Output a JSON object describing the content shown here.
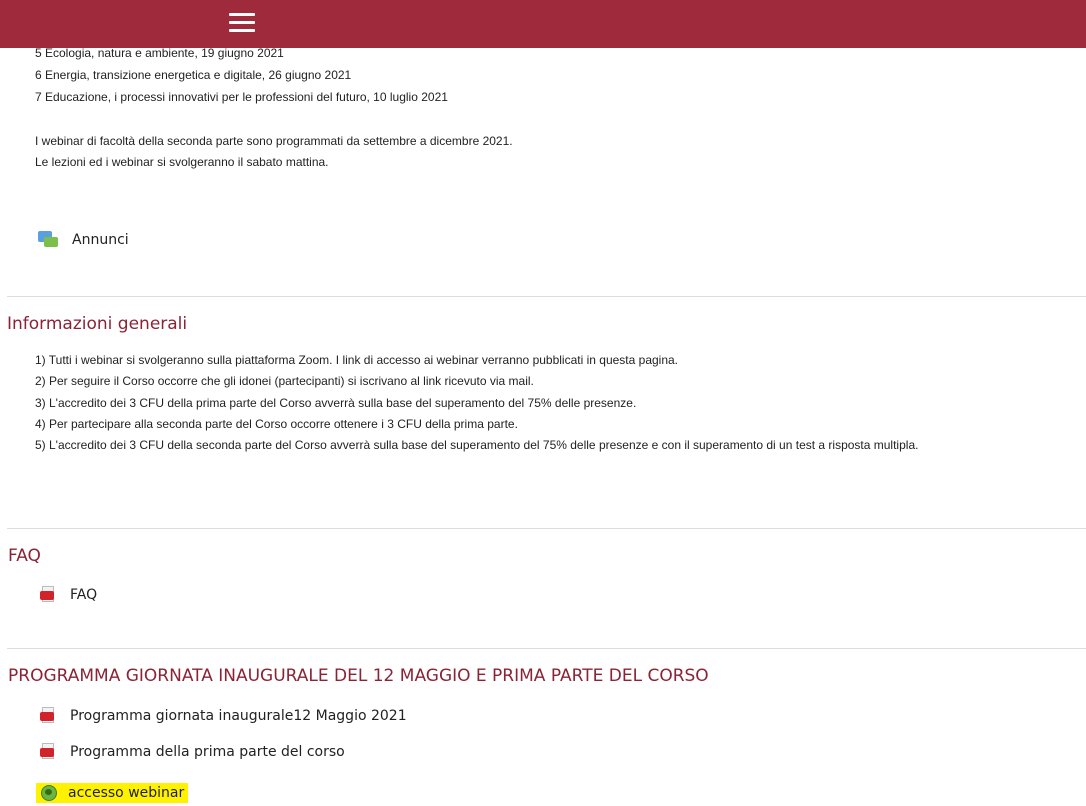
{
  "topbar": {
    "menu_icon": "hamburger-menu-icon",
    "color": "#9e2a3c"
  },
  "intro": {
    "partial_line": "5 Ecologia, natura e ambiente, 19 giugno 2021",
    "line6": "6 Energia, transizione energetica e digitale, 26 giugno 2021",
    "line7": "7 Educazione, i processi innovativi per le professioni del futuro, 10 luglio 2021",
    "para1": "I webinar di facoltà della seconda parte sono programmati da settembre a dicembre 2021.",
    "para2": "Le lezioni ed i webinar si svolgeranno il sabato mattina."
  },
  "announcements": {
    "label": "Annunci",
    "icon": "forum-icon"
  },
  "general_info": {
    "title": "Informazioni generali",
    "items": [
      "1) Tutti i webinar si svolgeranno sulla piattaforma Zoom. I link di accesso ai webinar verranno pubblicati in questa pagina.",
      "2) Per seguire il Corso occorre che gli idonei (partecipanti) si iscrivano al link ricevuto via mail.",
      "3) L'accredito dei  3 CFU della prima parte del Corso avverrà sulla base del superamento del 75% delle presenze.",
      "4) Per partecipare alla seconda parte del Corso occorre ottenere i 3 CFU della prima parte.",
      "5) L'accredito dei  3 CFU della seconda parte del Corso avverrà sulla base del superamento del 75% delle presenze e con il superamento di un test a risposta multipla."
    ]
  },
  "faq": {
    "title": "FAQ",
    "item_label": "FAQ",
    "icon": "pdf-icon"
  },
  "programma": {
    "title": "PROGRAMMA GIORNATA INAUGURALE DEL 12 MAGGIO E PRIMA PARTE DEL CORSO",
    "items": [
      {
        "label": "Programma giornata inaugurale12 Maggio 2021",
        "icon": "pdf-icon"
      },
      {
        "label": "Programma della prima parte del corso",
        "icon": "pdf-icon"
      },
      {
        "label": "accesso webinar",
        "icon": "url-globe-icon"
      }
    ]
  },
  "colors": {
    "section_title": "#8a2335",
    "highlight": "#fff200"
  }
}
